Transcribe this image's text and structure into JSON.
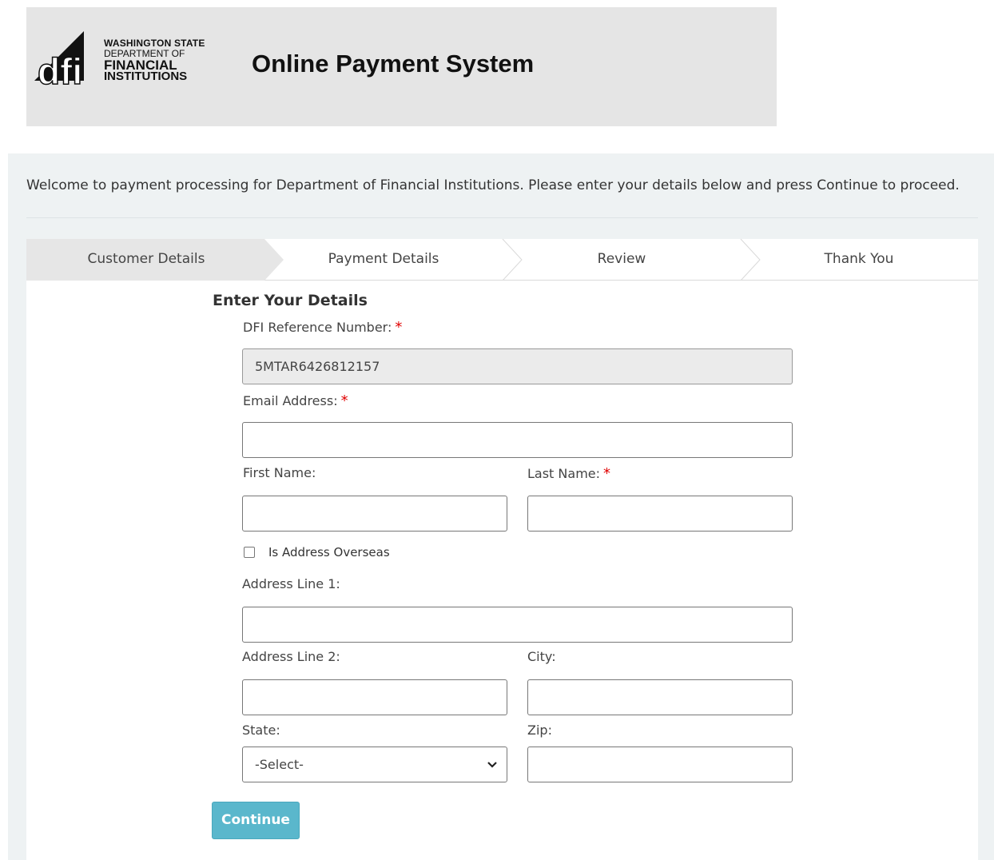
{
  "header": {
    "logo_line1": "WASHINGTON STATE",
    "logo_line2": "DEPARTMENT OF",
    "logo_line3": "FINANCIAL",
    "logo_line4": "INSTITUTIONS",
    "logo_mark": "dfi",
    "title": "Online Payment System"
  },
  "welcome": "Welcome to payment processing for Department of Financial Institutions. Please enter your details below and press Continue to proceed.",
  "steps": [
    "Customer Details",
    "Payment Details",
    "Review",
    "Thank You"
  ],
  "active_step": 0,
  "form": {
    "title": "Enter Your Details",
    "reference": {
      "label": "DFI Reference Number:",
      "value": "5MTAR6426812157"
    },
    "email": {
      "label": "Email Address:",
      "value": ""
    },
    "first_name": {
      "label": "First Name:",
      "value": ""
    },
    "last_name": {
      "label": "Last Name:",
      "value": ""
    },
    "overseas": {
      "label": "Is Address Overseas",
      "checked": false
    },
    "address1": {
      "label": "Address Line 1:",
      "value": ""
    },
    "address2": {
      "label": "Address Line 2:",
      "value": ""
    },
    "city": {
      "label": "City:",
      "value": ""
    },
    "state": {
      "label": "State:",
      "selected": "-Select-"
    },
    "zip": {
      "label": "Zip:",
      "value": ""
    },
    "required_marker": "*",
    "continue_label": "Continue"
  },
  "colors": {
    "header_bg": "#e5e5e5",
    "panel_bg": "#eef2f3",
    "active_step_bg": "#e6e6e6",
    "button_bg": "#5ab7cc",
    "required": "#e00000"
  },
  "icons": {
    "logo": "dfi-logo-icon",
    "select": "chevron-down-icon"
  }
}
